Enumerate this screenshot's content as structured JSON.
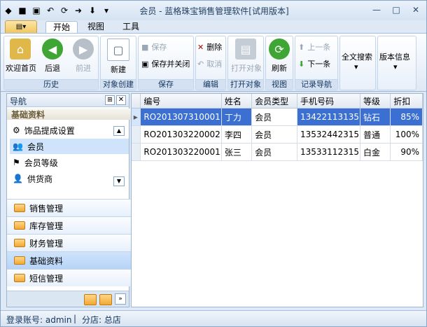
{
  "window": {
    "title": "会员 - 蓝格珠宝销售管理软件[试用版本]",
    "quick_access_icons": [
      "app-menu-icon",
      "save-icon",
      "save-as-icon",
      "undo-icon",
      "refresh-icon",
      "forward-icon",
      "down-icon",
      "customize-icon"
    ]
  },
  "tabs": {
    "app_button": "▤▾",
    "items": [
      "开始",
      "视图",
      "工具"
    ]
  },
  "ribbon": {
    "groups": {
      "history": {
        "title": "历史",
        "home": "欢迎首页",
        "back": "后退",
        "forward": "前进"
      },
      "create": {
        "title": "对象创建",
        "new": "新建"
      },
      "save": {
        "title": "保存",
        "save": "保存",
        "save_close": "保存并关闭"
      },
      "edit": {
        "title": "编辑",
        "delete": "删除",
        "cancel": "取消"
      },
      "open": {
        "title": "打开对象",
        "open": "打开对象"
      },
      "view": {
        "title": "视图",
        "refresh": "刷新"
      },
      "nav": {
        "title": "记录导航",
        "prev": "上一条",
        "next": "下一条"
      },
      "search": {
        "label": "全文搜索"
      },
      "version": {
        "label": "版本信息"
      }
    }
  },
  "nav": {
    "header": "导航",
    "section": "基础资料",
    "items": [
      "饰品提成设置",
      "会员",
      "会员等级",
      "供货商"
    ],
    "bottom_items": [
      "销售管理",
      "库存管理",
      "财务管理",
      "基础资料",
      "短信管理"
    ]
  },
  "grid": {
    "columns": [
      "编号",
      "姓名",
      "会员类型",
      "手机号码",
      "等级",
      "折扣"
    ],
    "rows": [
      [
        "RO201307310001",
        "丁力",
        "会员",
        "13422113135",
        "钻石",
        "85%"
      ],
      [
        "RO201303220002",
        "李四",
        "会员",
        "13532442315",
        "普通",
        "100%"
      ],
      [
        "RO201303220001",
        "张三",
        "会员",
        "13533112315",
        "白金",
        "90%"
      ]
    ]
  },
  "status": {
    "account": "登录账号: admin",
    "branch": "分店: 总店"
  },
  "colors": {
    "accent": "#3b6fd1",
    "ribbon_group_title": "#d3e1f2",
    "selection": "#d4e6fb"
  }
}
